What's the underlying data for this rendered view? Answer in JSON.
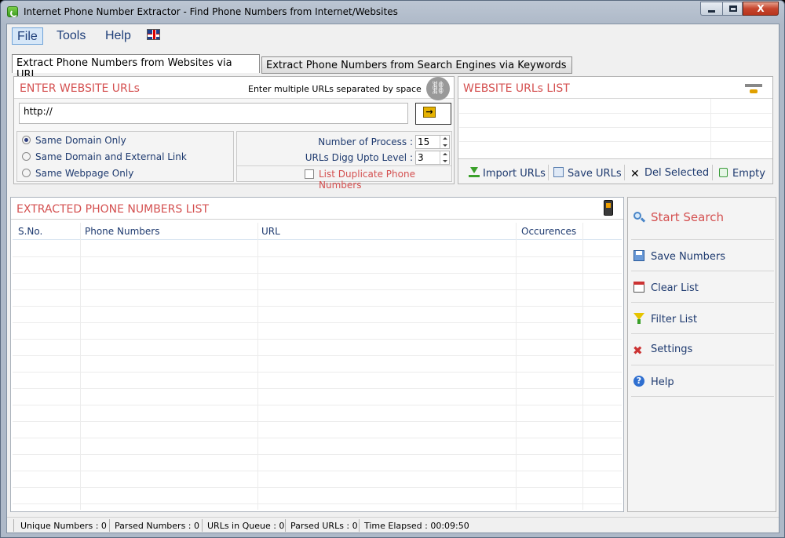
{
  "window": {
    "title": "Internet Phone Number Extractor - Find Phone Numbers from Internet/Websites",
    "close_label": "X"
  },
  "menu": {
    "file": "File",
    "tools": "Tools",
    "help": "Help",
    "language_icon": "uk-flag-icon"
  },
  "tabs": [
    {
      "label": "Extract Phone Numbers from Websites via URL",
      "selected": true
    },
    {
      "label": "Extract Phone Numbers from Search Engines via Keywords",
      "selected": false
    }
  ],
  "url_panel": {
    "title": "ENTER WEBSITE URLs",
    "hint": "Enter multiple URLs separated by space",
    "input_value": "http://",
    "go_icon": "arrow-right-icon",
    "link_icon": "chain-link-icon"
  },
  "options": {
    "radios": [
      {
        "label": "Same Domain Only",
        "checked": true
      },
      {
        "label": "Same Domain and External Link",
        "checked": false
      },
      {
        "label": "Same Webpage Only",
        "checked": false
      }
    ],
    "process_label": "Number of Process :",
    "process_value": "15",
    "digg_label": "URLs Digg Upto Level :",
    "digg_value": "3",
    "duplicate_label": "List Duplicate Phone Numbers",
    "duplicate_checked": false
  },
  "url_list": {
    "title": "WEBSITE URLs LIST",
    "import": "Import URLs",
    "save": "Save URLs",
    "del": "Del Selected",
    "empty": "Empty"
  },
  "phone_list": {
    "title": "EXTRACTED PHONE NUMBERS LIST",
    "columns": [
      "S.No.",
      "Phone Numbers",
      "URL",
      "Occurences"
    ]
  },
  "sidebar": {
    "start": "Start Search",
    "save": "Save Numbers",
    "clear": "Clear List",
    "filter": "Filter List",
    "settings": "Settings",
    "help": "Help"
  },
  "status": {
    "unique": "Unique Numbers :",
    "unique_val": "0",
    "parsed": "Parsed Numbers :",
    "parsed_val": "0",
    "queue": "URLs in Queue :",
    "queue_val": "0",
    "parsed_urls": "Parsed URLs :",
    "parsed_urls_val": "0",
    "elapsed": "Time Elapsed :",
    "elapsed_val": "00:09:50"
  },
  "colors": {
    "accent_red": "#d45050",
    "text_blue": "#1e3a6f"
  }
}
